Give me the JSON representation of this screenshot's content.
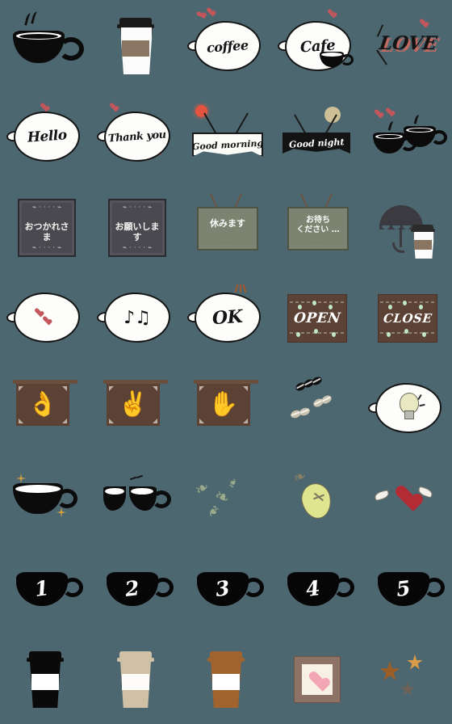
{
  "sheet": {
    "title": "Coffee Cafe Emoji Sticker Sheet",
    "background_color": "#4d6770",
    "columns": 5,
    "rows": 8,
    "total_stickers": 40
  },
  "palette": {
    "background": "#4d6770",
    "black": "#0b0b0b",
    "bubble_white": "#fdfdfb",
    "wood_brown": "#5b4234",
    "chalk_slate": "#4b4950",
    "sign_olive": "#7c8471",
    "cup_beige": "#cfc0a6",
    "cup_brown": "#a0622e",
    "heart_red": "#b32b33",
    "heart_pink": "#f2a6b4",
    "lemon_green": "#dfe48e",
    "light_green": "#bfe7c4",
    "sun_red": "#e4543c",
    "star_gold": "#d7a13c",
    "love_shadow": "#c26a62"
  },
  "stickers": [
    {
      "id": 1,
      "name": "hot-coffee-mug",
      "label": "",
      "icon": "coffee-mug-icon"
    },
    {
      "id": 2,
      "name": "takeout-cup-white",
      "label": "",
      "icon": "takeout-cup-icon"
    },
    {
      "id": 3,
      "name": "coffee-word-bubble",
      "label": "coffee",
      "icon": "speech-bubble-icon"
    },
    {
      "id": 4,
      "name": "cafe-word-bubble",
      "label": "Cafe",
      "icon": "speech-bubble-icon"
    },
    {
      "id": 5,
      "name": "love-text",
      "label": "LOVE",
      "icon": "love-text-icon"
    },
    {
      "id": 6,
      "name": "hello-bubble",
      "label": "Hello",
      "icon": "speech-bubble-icon"
    },
    {
      "id": 7,
      "name": "thank-you-bubble",
      "label": "Thank you",
      "icon": "speech-bubble-icon"
    },
    {
      "id": 8,
      "name": "good-morning-banner",
      "label": "Good morning",
      "icon": "banner-sun-icon"
    },
    {
      "id": 9,
      "name": "good-night-banner",
      "label": "Good night",
      "icon": "banner-moon-icon"
    },
    {
      "id": 10,
      "name": "two-coffee-cups-hearts",
      "label": "",
      "icon": "two-cups-icon"
    },
    {
      "id": 11,
      "name": "chalkboard-otsukaresama",
      "label": "おつかれさま",
      "icon": "chalkboard-icon"
    },
    {
      "id": 12,
      "name": "chalkboard-onegaishimasu",
      "label": "お願いします",
      "icon": "chalkboard-icon"
    },
    {
      "id": 13,
      "name": "hanging-sign-yasumimasu",
      "label": "休みます",
      "icon": "hanging-sign-icon"
    },
    {
      "id": 14,
      "name": "hanging-sign-omachi",
      "label": "お待ち\nください …",
      "icon": "hanging-sign-icon"
    },
    {
      "id": 15,
      "name": "umbrella-with-cup",
      "label": "",
      "icon": "umbrella-icon"
    },
    {
      "id": 16,
      "name": "hearts-bubble",
      "label": "",
      "icon": "speech-bubble-icon"
    },
    {
      "id": 17,
      "name": "music-notes-bubble",
      "label": "",
      "icon": "music-note-icon"
    },
    {
      "id": 18,
      "name": "ok-bubble",
      "label": "OK",
      "icon": "speech-bubble-icon"
    },
    {
      "id": 19,
      "name": "open-sign",
      "label": "OPEN",
      "icon": "wood-sign-icon"
    },
    {
      "id": 20,
      "name": "close-sign",
      "label": "CLOSE",
      "icon": "wood-sign-icon"
    },
    {
      "id": 21,
      "name": "ok-hand-board",
      "label": "",
      "icon": "ok-hand-icon"
    },
    {
      "id": 22,
      "name": "peace-hand-board",
      "label": "",
      "icon": "peace-hand-icon"
    },
    {
      "id": 23,
      "name": "waving-hand-board",
      "label": "",
      "icon": "waving-hand-icon"
    },
    {
      "id": 24,
      "name": "coffee-beans",
      "label": "",
      "icon": "coffee-bean-icon"
    },
    {
      "id": 25,
      "name": "lightbulb-bubble",
      "label": "",
      "icon": "lightbulb-icon"
    },
    {
      "id": 26,
      "name": "empty-cup-sparkle",
      "label": "",
      "icon": "empty-cup-icon"
    },
    {
      "id": 27,
      "name": "broken-cup",
      "label": "",
      "icon": "broken-cup-icon"
    },
    {
      "id": 28,
      "name": "olive-branch",
      "label": "",
      "icon": "leaf-sprig-icon"
    },
    {
      "id": 29,
      "name": "lemon-leaf",
      "label": "",
      "icon": "lemon-icon"
    },
    {
      "id": 30,
      "name": "winged-heart",
      "label": "",
      "icon": "winged-heart-icon"
    },
    {
      "id": 31,
      "name": "number-cup-1",
      "label": "1",
      "icon": "number-cup-icon"
    },
    {
      "id": 32,
      "name": "number-cup-2",
      "label": "2",
      "icon": "number-cup-icon"
    },
    {
      "id": 33,
      "name": "number-cup-3",
      "label": "3",
      "icon": "number-cup-icon"
    },
    {
      "id": 34,
      "name": "number-cup-4",
      "label": "4",
      "icon": "number-cup-icon"
    },
    {
      "id": 35,
      "name": "number-cup-5",
      "label": "5",
      "icon": "number-cup-icon"
    },
    {
      "id": 36,
      "name": "takeout-cup-black",
      "label": "",
      "icon": "takeout-cup-icon"
    },
    {
      "id": 37,
      "name": "takeout-cup-beige",
      "label": "",
      "icon": "takeout-cup-icon"
    },
    {
      "id": 38,
      "name": "takeout-cup-brown",
      "label": "",
      "icon": "takeout-cup-icon"
    },
    {
      "id": 39,
      "name": "heart-picture-frame",
      "label": "",
      "icon": "picture-frame-icon"
    },
    {
      "id": 40,
      "name": "three-stars",
      "label": "",
      "icon": "star-icon"
    }
  ]
}
